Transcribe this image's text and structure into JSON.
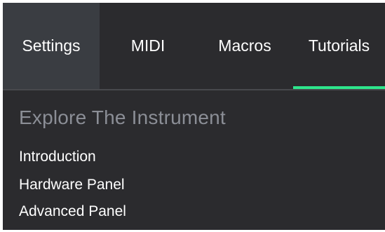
{
  "tabs": [
    {
      "label": "Settings"
    },
    {
      "label": "MIDI"
    },
    {
      "label": "Macros"
    },
    {
      "label": "Tutorials"
    }
  ],
  "active_tab": "Tutorials",
  "section": {
    "title": "Explore The Instrument",
    "items": [
      {
        "label": "Introduction"
      },
      {
        "label": "Hardware Panel"
      },
      {
        "label": "Advanced Panel"
      }
    ]
  },
  "colors": {
    "background": "#2b2b2e",
    "settings_tab_bg": "#3a3d42",
    "accent": "#2ee68c",
    "section_title": "#8b8e96"
  }
}
